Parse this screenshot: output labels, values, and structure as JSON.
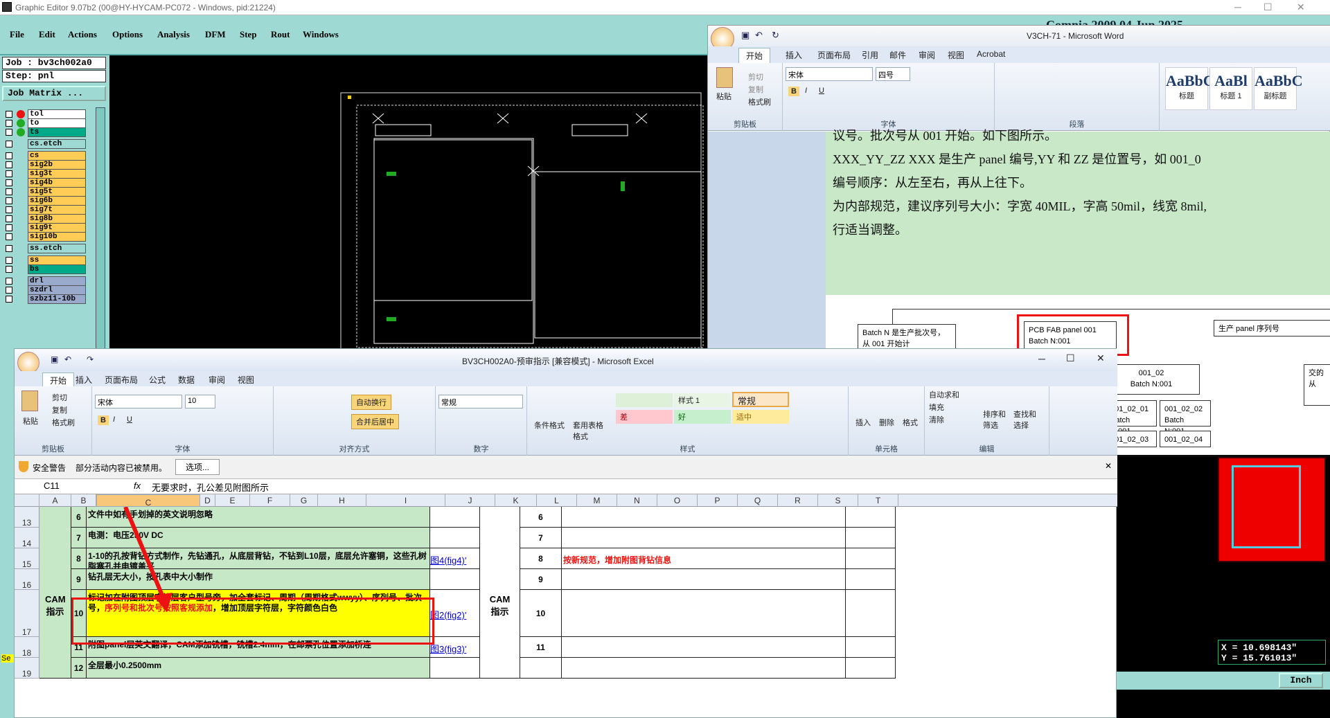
{
  "ge": {
    "title": "Graphic Editor 9.07b2 (00@HY-HYCAM-PC072 - Windows, pid:21224)",
    "menu": [
      "File",
      "Edit",
      "Actions",
      "Options",
      "Analysis",
      "DFM",
      "Step",
      "Rout",
      "Windows"
    ],
    "job": "Job : bv3ch002a0",
    "step": "Step: pnl",
    "job_matrix": "Job Matrix ...",
    "layers": [
      "tol",
      "to",
      "ts",
      "cs.etch",
      "cs",
      "sig2b",
      "sig3t",
      "sig4b",
      "sig5t",
      "sig6b",
      "sig7t",
      "sig8b",
      "sig9t",
      "sig10b",
      "ss.etch",
      "ss",
      "bs",
      "drl",
      "szdrl",
      "szbz11-10b"
    ],
    "coord_x": "X = 10.698143\"",
    "coord_y": "Y = 15.761013\"",
    "units": "Inch",
    "side_label": "Se",
    "corner_text": "Comnia 2009 04 Jun 2025"
  },
  "word": {
    "title": "V3CH-71 - Microsoft Word",
    "tabs": [
      "开始",
      "插入",
      "页面布局",
      "引用",
      "邮件",
      "审阅",
      "视图",
      "Acrobat"
    ],
    "clipboard": {
      "paste": "粘贴",
      "cut": "剪切",
      "copy": "复制",
      "format": "格式刷",
      "label": "剪贴板"
    },
    "font": {
      "name": "宋体",
      "size": "四号",
      "label": "字体"
    },
    "para_label": "段落",
    "styles": [
      {
        "sample": "AaBbC",
        "name": "标题"
      },
      {
        "sample": "AaBl",
        "name": "标题 1"
      },
      {
        "sample": "AaBbC",
        "name": "副标题"
      }
    ],
    "lines": [
      "议号。批次号从 001 开始。如下图所示。",
      "XXX_YY_ZZ   XXX 是生产 panel 编号,YY 和 ZZ   是位置号，如 001_0",
      "编号顺序：从左至右，再从上往下。",
      "为内部规范，建议序列号大小：字宽 40MIL，字高 50mil，线宽 8mil,",
      "行适当调整。"
    ],
    "diagram": {
      "batch_note": "Batch N 是生产批次号，从 001 开始计",
      "pcb_box": "PCB FAB panel 001",
      "pcb_batch": "Batch N:001",
      "panel_note": "生产 panel 序列号",
      "side_note": "交的从",
      "boxes": [
        {
          "id": "001_02",
          "batch": "Batch N:001"
        },
        {
          "id": "001_02_01",
          "batch": "Batch N:001"
        },
        {
          "id": "001_02_02",
          "batch": "Batch N:001"
        },
        {
          "id": "001_02_03"
        },
        {
          "id": "001_02_04"
        }
      ],
      "left_frag": "2",
      "left_frag2": "01"
    }
  },
  "excel": {
    "title": "BV3CH002A0-预审指示 [兼容模式] - Microsoft Excel",
    "tabs": [
      "开始",
      "插入",
      "页面布局",
      "公式",
      "数据",
      "审阅",
      "视图"
    ],
    "clipboard": {
      "cut": "剪切",
      "copy": "复制",
      "paste": "粘贴",
      "format": "格式刷",
      "label": "剪贴板"
    },
    "font": {
      "name": "宋体",
      "size": "10",
      "label": "字体"
    },
    "align": {
      "wrap": "自动换行",
      "merge": "合并后居中",
      "label": "对齐方式"
    },
    "number": {
      "format": "常规",
      "label": "数字"
    },
    "styles": {
      "cond": "条件格式",
      "table": "套用表格格式",
      "style1": "样式 1",
      "normal": "常规",
      "bad": "差",
      "good": "好",
      "neutral": "适中",
      "label": "样式"
    },
    "cells": {
      "insert": "插入",
      "delete": "删除",
      "format": "格式",
      "label": "单元格"
    },
    "edit": {
      "autosum": "自动求和",
      "fill": "填充",
      "clear": "清除",
      "sort": "排序和筛选",
      "find": "查找和选择",
      "label": "编辑"
    },
    "security": {
      "icon": "shield-icon",
      "title": "安全警告",
      "msg": "部分活动内容已被禁用。",
      "options": "选项..."
    },
    "namebox": "C11",
    "formula": "无要求时，孔公差见附图所示",
    "columns": [
      "A",
      "B",
      "C",
      "D",
      "E",
      "F",
      "G",
      "H",
      "I",
      "J",
      "K",
      "L",
      "M",
      "N",
      "O",
      "P",
      "Q",
      "R",
      "S",
      "T"
    ],
    "rows": [
      {
        "rh": "13",
        "n": "6",
        "text": "文件中如有手划掉的英文说明忽略",
        "n2": "6",
        "note": "",
        "link": ""
      },
      {
        "rh": "14",
        "n": "7",
        "text": "电测：电压250V DC",
        "n2": "7",
        "note": "",
        "link": ""
      },
      {
        "rh": "15",
        "n": "8",
        "text": "1-10的孔按背钻方式制作，先钻通孔，从底层背钻，不钻到L10层，底层允许塞铜，这些孔树脂塞孔并电镀盖平",
        "n2": "8",
        "note": "按新规范，增加附图背钻信息",
        "link": "图4(fig4)'"
      },
      {
        "rh": "16",
        "n": "9",
        "text": "钻孔层无大小，按孔表中大小制作",
        "n2": "9",
        "note": "",
        "link": ""
      },
      {
        "rh": "17",
        "n": "10",
        "text": "标记加在附图顶层字符层客户型号旁，加全套标记、周期（周期格式wwyy）、序列号、批次号，",
        "text_red": "序列号和批次号按照客规添加",
        "text_tail": "，增加顶层字符层，字符颜色白色",
        "n2": "10",
        "note": "",
        "link": "图2(fig2)'"
      },
      {
        "rh": "18",
        "n": "11",
        "text": "附图panel层英文翻译，CAM添加铣槽，铣槽2.4mm，在邮票孔位置添加桥连",
        "n2": "11",
        "note": "",
        "link": "图3(fig3)'"
      },
      {
        "rh": "19",
        "n": "12",
        "text": "全层最小0.2500mm",
        "n2": "",
        "note": "",
        "link": ""
      }
    ],
    "cam": "CAM指示"
  }
}
